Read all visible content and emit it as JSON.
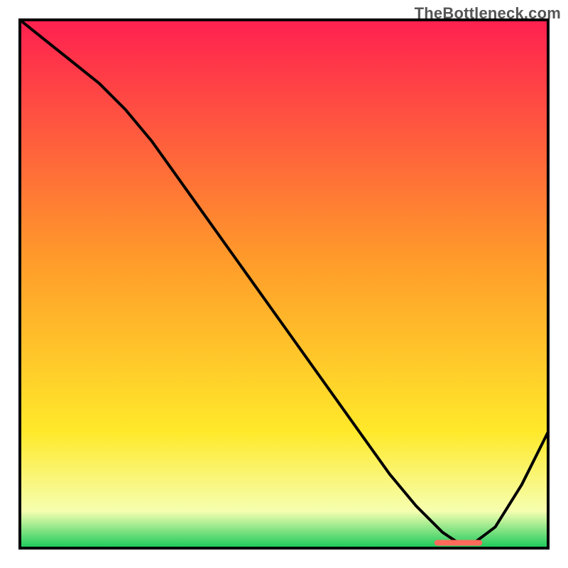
{
  "watermark": "TheBottleneck.com",
  "chart_data": {
    "type": "line",
    "title": "",
    "xlabel": "",
    "ylabel": "",
    "xlim": [
      0,
      100
    ],
    "ylim": [
      0,
      100
    ],
    "background_gradient": {
      "top": "#ff2050",
      "mid_upper": "#ff9a2a",
      "mid_lower": "#ffe92a",
      "near_bottom": "#f6ffb0",
      "bottom": "#18c95a"
    },
    "series": [
      {
        "name": "curve",
        "color": "#000000",
        "x": [
          0,
          5,
          10,
          15,
          20,
          25,
          30,
          35,
          40,
          45,
          50,
          55,
          60,
          65,
          70,
          75,
          80,
          83,
          86,
          90,
          95,
          100
        ],
        "y": [
          100,
          96,
          92,
          88,
          83,
          77,
          70,
          63,
          56,
          49,
          42,
          35,
          28,
          21,
          14,
          8,
          3,
          1,
          1,
          4,
          12,
          22
        ]
      },
      {
        "name": "optimal-marker",
        "type": "segment",
        "color": "#ff6a5a",
        "x": [
          79,
          87
        ],
        "y": [
          1,
          1
        ]
      }
    ]
  }
}
